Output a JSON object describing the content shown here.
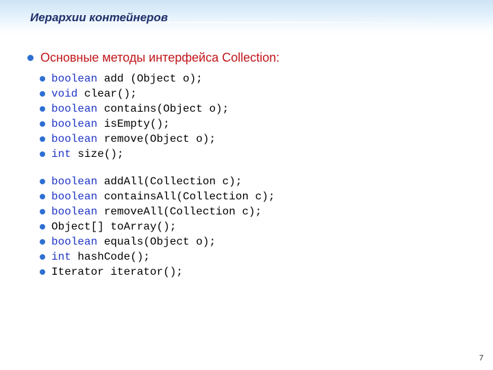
{
  "slide_title": "Иерархии контейнеров",
  "section_label": "Основные методы интерфейса Collection:",
  "page_number": "7",
  "method_groups": [
    [
      {
        "kw": "boolean",
        "rest": " add (Object o);"
      },
      {
        "kw": "void",
        "rest": " clear();"
      },
      {
        "kw": "boolean",
        "rest": " contains(Object o);"
      },
      {
        "kw": "boolean",
        "rest": " isEmpty();"
      },
      {
        "kw": "boolean",
        "rest": " remove(Object o);"
      },
      {
        "kw": "int",
        "rest": " size();"
      }
    ],
    [
      {
        "kw": "boolean",
        "rest": " addAll(Collection c);"
      },
      {
        "kw": "boolean",
        "rest": " containsAll(Collection c);"
      },
      {
        "kw": "boolean",
        "rest": " removeAll(Collection c);"
      },
      {
        "kw": "",
        "rest": "Object[] toArray();"
      },
      {
        "kw": "boolean",
        "rest": " equals(Object o);"
      },
      {
        "kw": "int",
        "rest": " hashCode();"
      },
      {
        "kw": "",
        "rest": "Iterator iterator();"
      }
    ]
  ]
}
